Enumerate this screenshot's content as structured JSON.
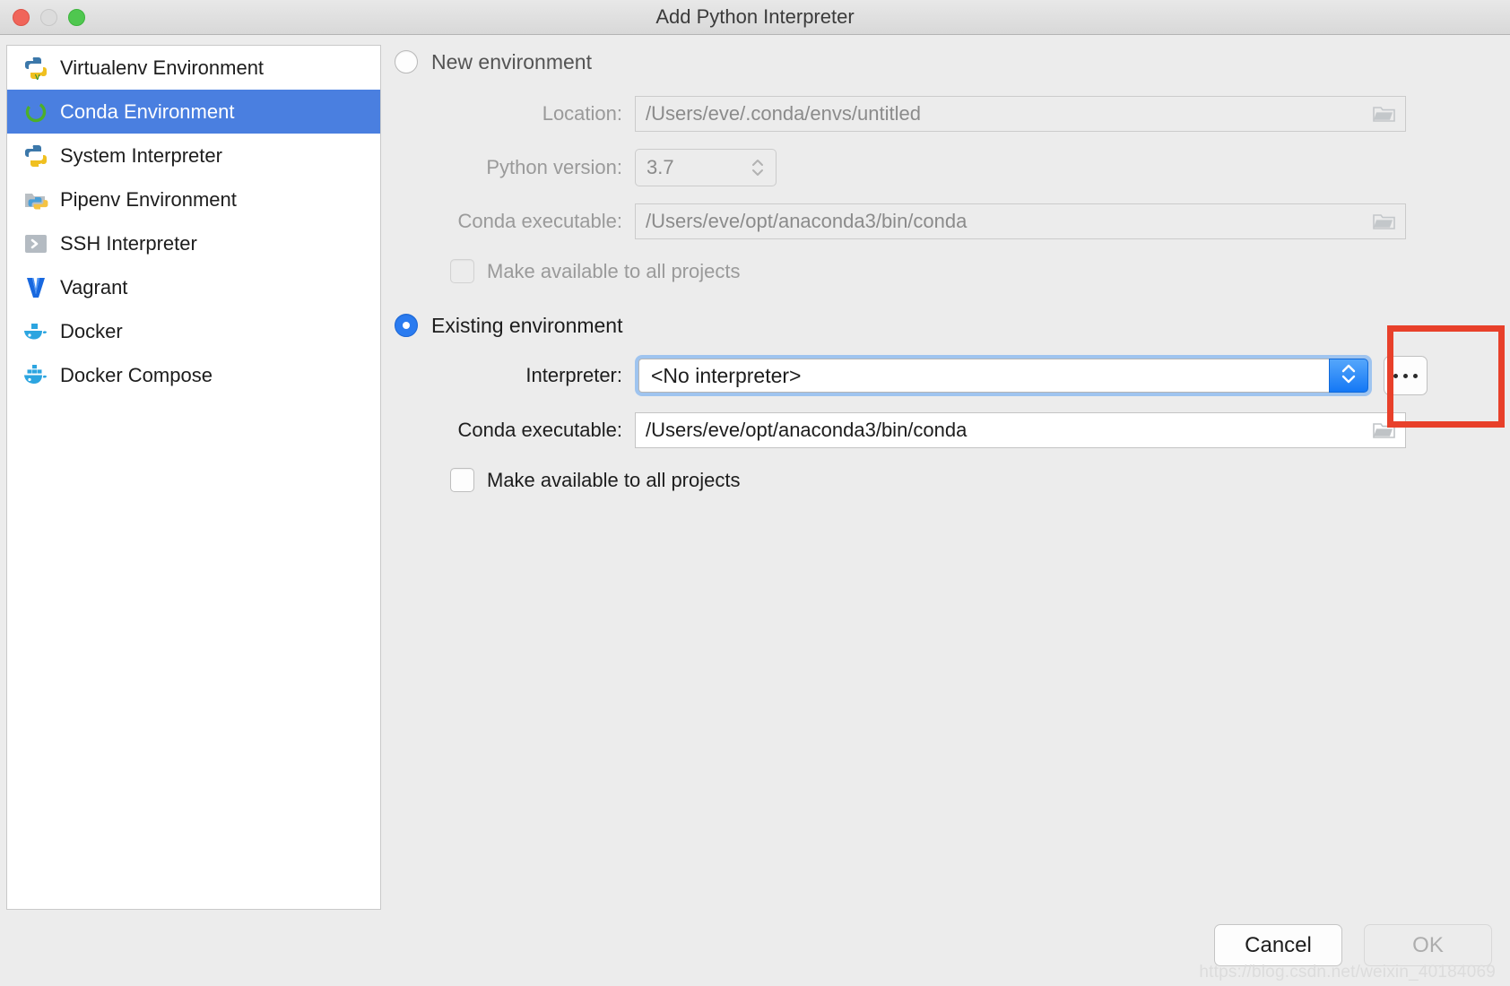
{
  "window": {
    "title": "Add Python Interpreter",
    "traffic_lights": [
      "close-button",
      "minimize-button",
      "maximize-button"
    ]
  },
  "colors": {
    "selection_blue": "#4a7fe0",
    "accent_blue": "#2a7bf0",
    "stepper_blue": "#1478f5",
    "focus_ring": "#9fc4ef",
    "annotation_red": "#e8402a",
    "panel_gray": "#ececec"
  },
  "sidebar": {
    "items": [
      {
        "label": "Virtualenv Environment",
        "icon": "python-virtualenv-icon",
        "selected": false
      },
      {
        "label": "Conda Environment",
        "icon": "conda-icon",
        "selected": true
      },
      {
        "label": "System Interpreter",
        "icon": "python-icon",
        "selected": false
      },
      {
        "label": "Pipenv Environment",
        "icon": "pipenv-folder-icon",
        "selected": false
      },
      {
        "label": "SSH Interpreter",
        "icon": "ssh-terminal-icon",
        "selected": false
      },
      {
        "label": "Vagrant",
        "icon": "vagrant-icon",
        "selected": false
      },
      {
        "label": "Docker",
        "icon": "docker-icon",
        "selected": false
      },
      {
        "label": "Docker Compose",
        "icon": "docker-compose-icon",
        "selected": false
      }
    ]
  },
  "main": {
    "new_environment": {
      "radio_label": "New environment",
      "selected": false,
      "enabled": false,
      "location": {
        "label": "Location:",
        "value": "/Users/eve/.conda/envs/untitled",
        "browse_icon": "folder-icon"
      },
      "python_version": {
        "label": "Python version:",
        "value": "3.7",
        "stepper_icon": "up-down-chevron-icon"
      },
      "conda_executable": {
        "label": "Conda executable:",
        "value": "/Users/eve/opt/anaconda3/bin/conda",
        "browse_icon": "folder-icon"
      },
      "make_available": {
        "label": "Make available to all projects",
        "checked": false
      }
    },
    "existing_environment": {
      "radio_label": "Existing environment",
      "selected": true,
      "enabled": true,
      "interpreter": {
        "label": "Interpreter:",
        "value": "<No interpreter>",
        "stepper_icon": "up-down-chevron-icon",
        "browse_label": "...",
        "focused": true
      },
      "conda_executable": {
        "label": "Conda executable:",
        "value": "/Users/eve/opt/anaconda3/bin/conda",
        "browse_icon": "folder-icon"
      },
      "make_available": {
        "label": "Make available to all projects",
        "checked": false
      }
    }
  },
  "footer": {
    "cancel_label": "Cancel",
    "ok_label": "OK",
    "ok_enabled": false
  },
  "watermark": "https://blog.csdn.net/weixin_40184069"
}
